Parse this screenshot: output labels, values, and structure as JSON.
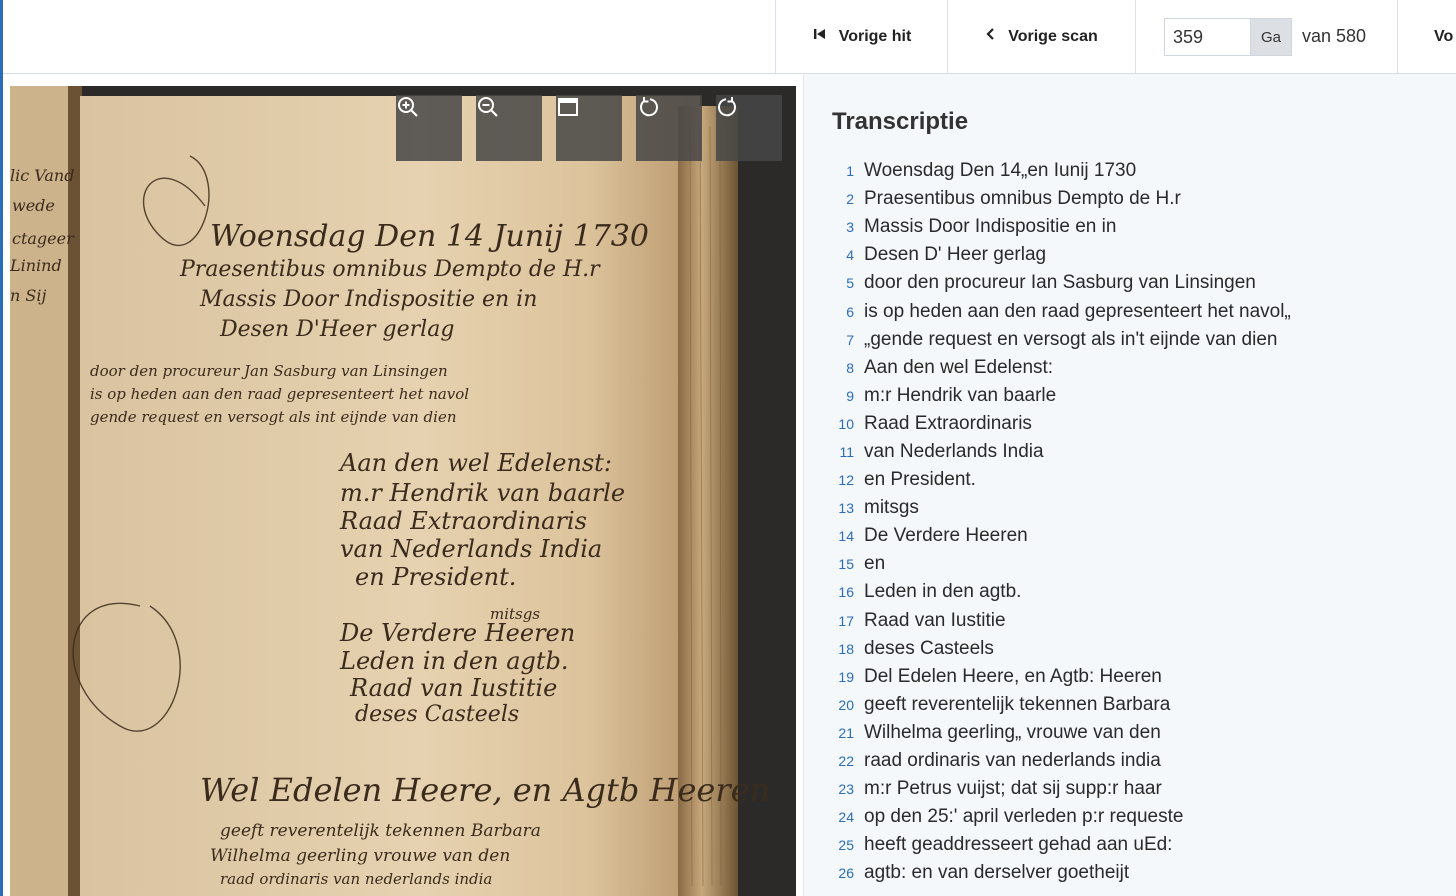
{
  "toolbar": {
    "prev_hit_label": "Vorige hit",
    "prev_scan_label": "Vorige scan",
    "page_value": "359",
    "go_label": "Ga",
    "of_label": "van 580",
    "next_label": "Vo"
  },
  "viewer": {
    "tools": [
      {
        "name": "zoom-in-icon"
      },
      {
        "name": "zoom-out-icon"
      },
      {
        "name": "fullscreen-icon"
      },
      {
        "name": "rotate-left-icon"
      },
      {
        "name": "rotate-right-icon"
      }
    ]
  },
  "transcript": {
    "title": "Transcriptie",
    "lines": [
      {
        "n": "1",
        "text": "Woensdag Den 14„en Iunij 1730"
      },
      {
        "n": "2",
        "text": "Praesentibus omnibus Dempto de H.r"
      },
      {
        "n": "3",
        "text": "Massis Door Indispositie en in"
      },
      {
        "n": "4",
        "text": "Desen D' Heer gerlag"
      },
      {
        "n": "5",
        "text": "door den procureur Ian Sasburg van Linsingen"
      },
      {
        "n": "6",
        "text": "is op heden aan den raad gepresenteert het navol„"
      },
      {
        "n": "7",
        "text": "„gende request en versogt als in't eijnde van dien"
      },
      {
        "n": "8",
        "text": "Aan den wel Edelenst:"
      },
      {
        "n": "9",
        "text": "m:r Hendrik van baarle"
      },
      {
        "n": "10",
        "text": "Raad Extraordinaris"
      },
      {
        "n": "11",
        "text": "van Nederlands India"
      },
      {
        "n": "12",
        "text": "en President."
      },
      {
        "n": "13",
        "text": "mitsgs"
      },
      {
        "n": "14",
        "text": "De Verdere Heeren"
      },
      {
        "n": "15",
        "text": "en"
      },
      {
        "n": "16",
        "text": "Leden in den agtb."
      },
      {
        "n": "17",
        "text": "Raad van Iustitie"
      },
      {
        "n": "18",
        "text": "deses Casteels"
      },
      {
        "n": "19",
        "text": "Del Edelen Heere, en Agtb: Heeren"
      },
      {
        "n": "20",
        "text": "geeft reverentelijk tekennen Barbara"
      },
      {
        "n": "21",
        "text": "Wilhelma geerling„ vrouwe van den"
      },
      {
        "n": "22",
        "text": "raad ordinaris van nederlands india"
      },
      {
        "n": "23",
        "text": "m:r Petrus vuijst; dat sij supp:r haar"
      },
      {
        "n": "24",
        "text": "op den 25:' april verleden p:r requeste"
      },
      {
        "n": "25",
        "text": "heeft geaddresseert gehad aan uEd:"
      },
      {
        "n": "26",
        "text": "agtb: en van derselver goetheijt"
      }
    ]
  }
}
